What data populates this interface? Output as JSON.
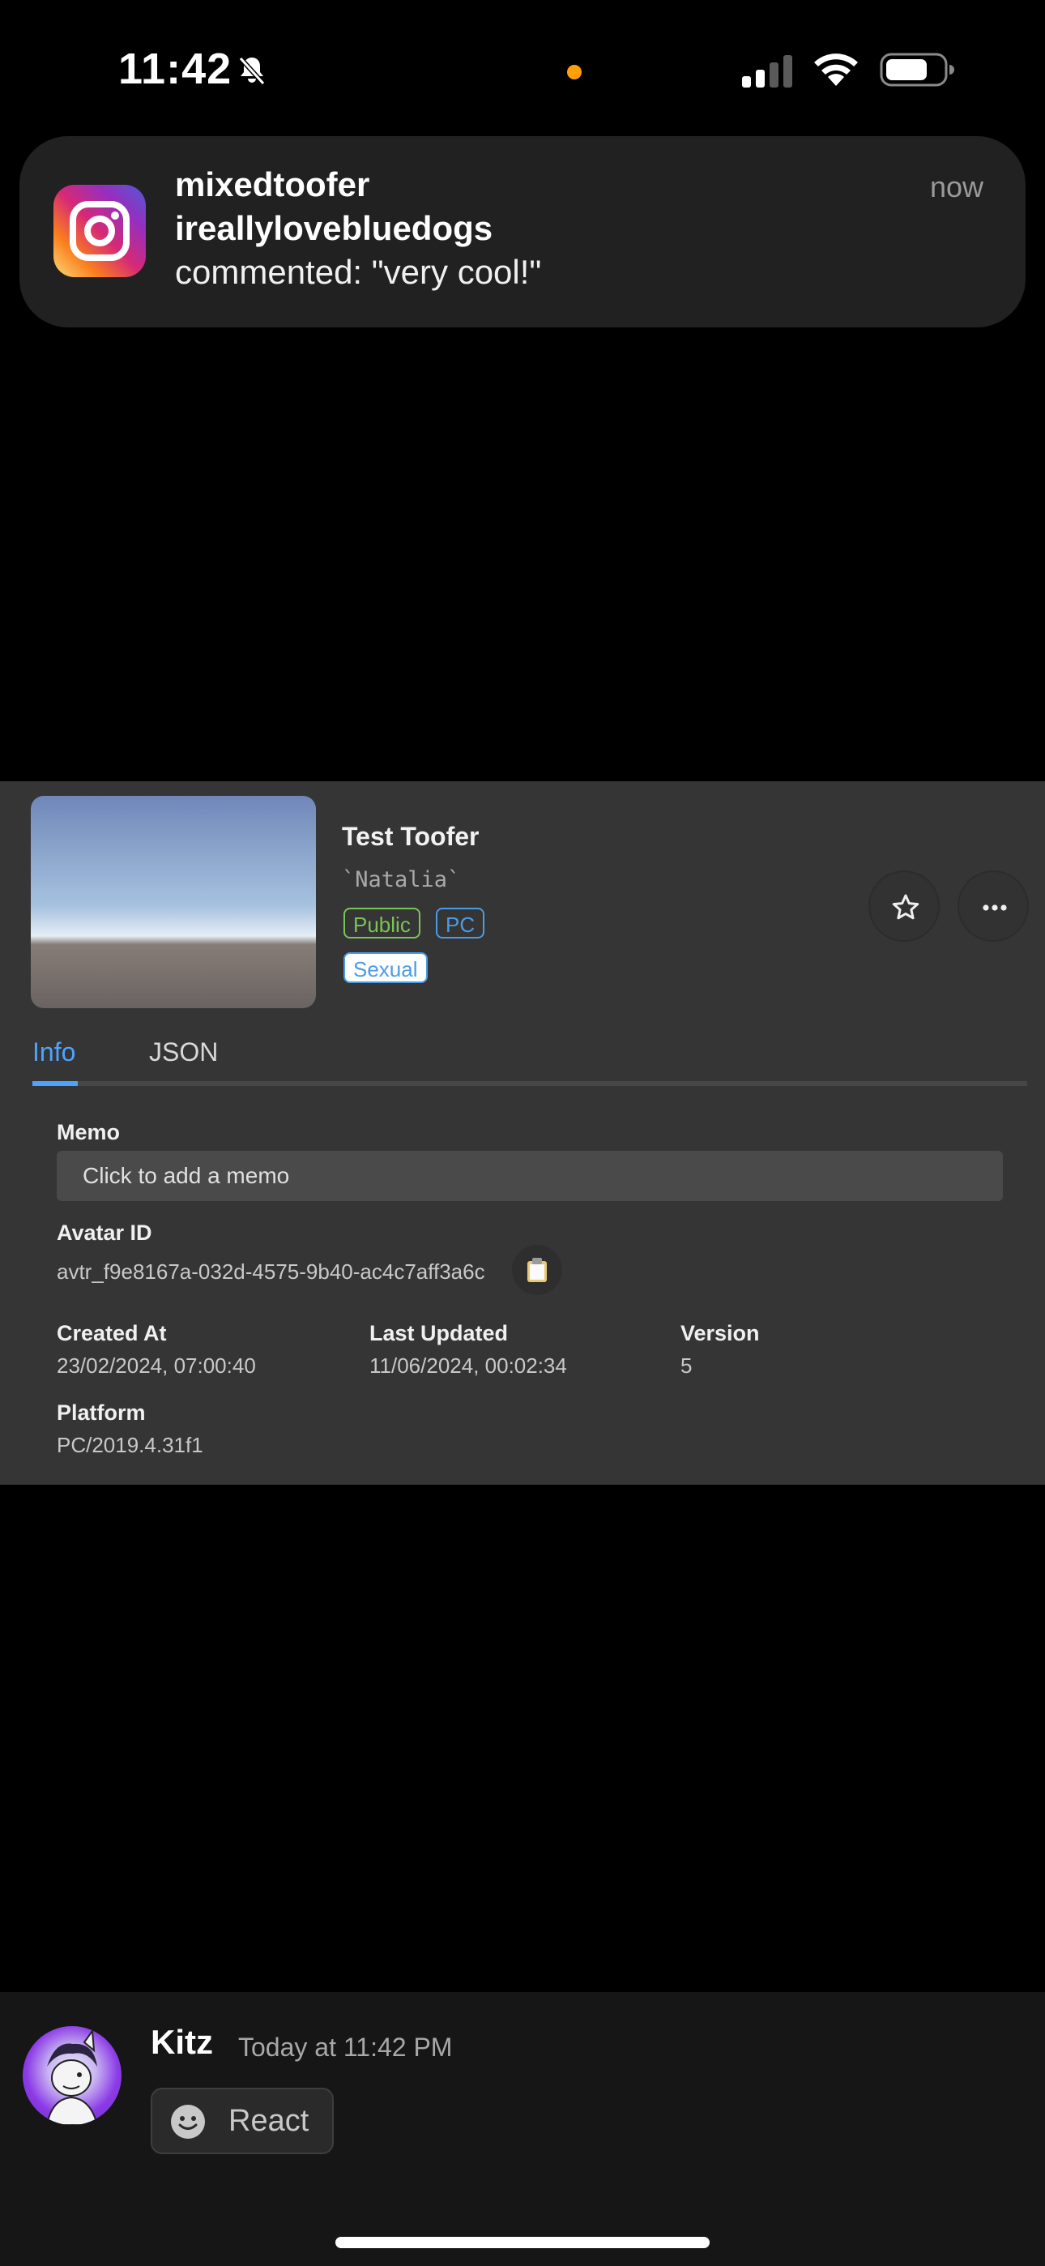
{
  "status_bar": {
    "time": "11:42",
    "icons": [
      "bell-off-icon",
      "privacy-dot-orange",
      "cellular-signal-icon",
      "wifi-icon",
      "battery-icon"
    ],
    "privacy_dot_color": "#ff9f0a"
  },
  "notification": {
    "app_icon": "instagram-icon",
    "title": "mixedtoofer",
    "subtitle": "ireallylovebluedogs",
    "body": "commented: \"very cool!\"",
    "time": "now"
  },
  "avatar_card": {
    "name": "Test Toofer",
    "author": "`Natalia`",
    "tags": {
      "release": "Public",
      "platform": "PC",
      "content": "Sexual"
    },
    "tag_colors": {
      "public": "#7ac356",
      "platform": "#4b9be6"
    },
    "actions": {
      "favorite_icon": "star-icon",
      "more_icon": "more-horizontal-icon"
    },
    "tabs": {
      "info": "Info",
      "json": "JSON",
      "active": "Info"
    },
    "accent": "#4da3ff",
    "memo": {
      "label": "Memo",
      "placeholder": "Click to add a memo"
    },
    "avatar_id": {
      "label": "Avatar ID",
      "value": "avtr_f9e8167a-032d-4575-9b40-ac4c7aff3a6c",
      "copy_icon": "clipboard-icon"
    },
    "created": {
      "label": "Created At",
      "value": "23/02/2024, 07:00:40"
    },
    "updated": {
      "label": "Last Updated",
      "value": "11/06/2024, 00:02:34"
    },
    "version": {
      "label": "Version",
      "value": "5"
    },
    "platform": {
      "label": "Platform",
      "value": "PC/2019.4.31f1"
    }
  },
  "message": {
    "username": "Kitz",
    "timestamp": "Today at 11:42 PM",
    "react_label": "React",
    "react_icon": "emoji-icon"
  }
}
